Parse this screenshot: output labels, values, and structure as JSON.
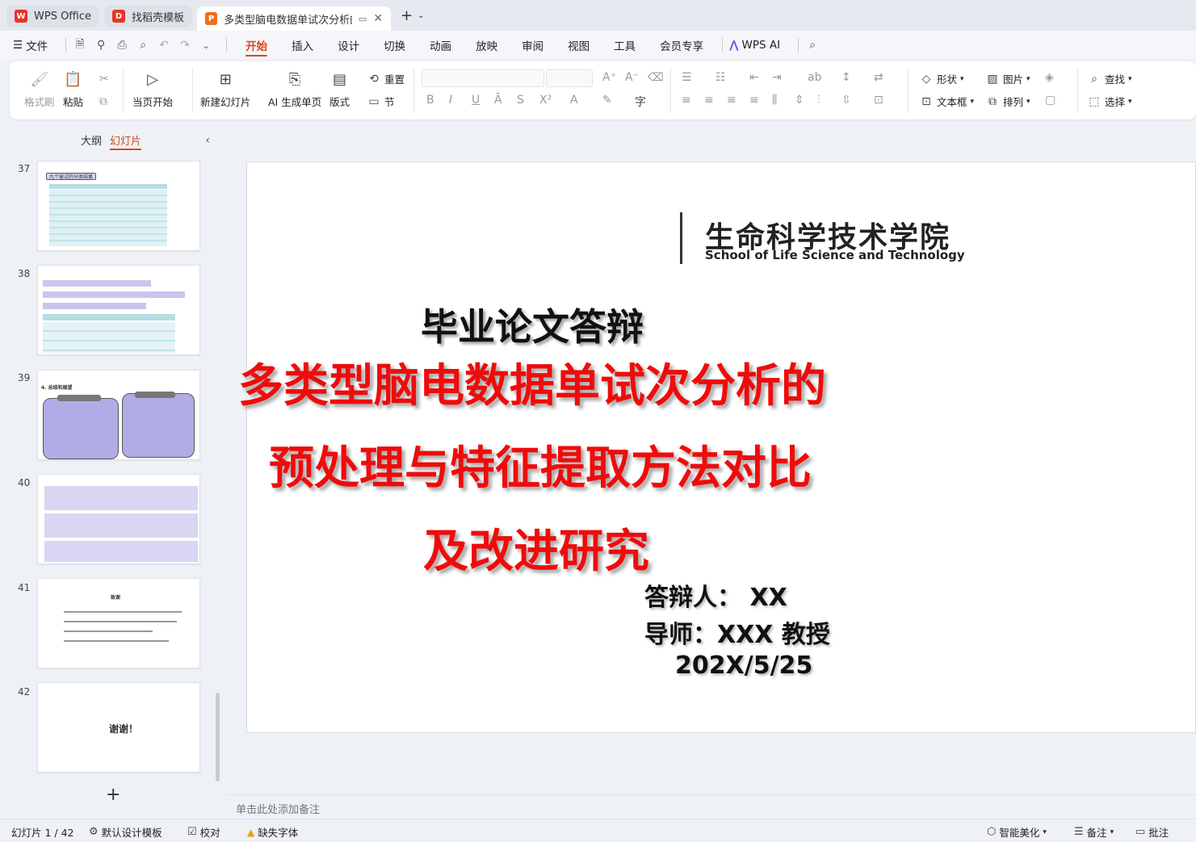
{
  "tabs": [
    {
      "label": "WPS Office",
      "logo": "W",
      "logo_color": "#e8332a"
    },
    {
      "label": "找稻壳模板",
      "logo": "D",
      "logo_color": "#e8332a"
    },
    {
      "label": "多类型脑电数据单试次分析的",
      "logo": "P",
      "logo_color": "#f26b1d"
    }
  ],
  "menubar": {
    "file": "文件",
    "tabs": [
      "开始",
      "插入",
      "设计",
      "切换",
      "动画",
      "放映",
      "审阅",
      "视图",
      "工具",
      "会员专享"
    ],
    "active_tab": "开始",
    "ai": "WPS AI"
  },
  "ribbon": {
    "format_painter": "格式刷",
    "paste": "粘贴",
    "start_from_current": "当页开始",
    "new_slide": "新建幻灯片",
    "ai_generate": "AI 生成单页",
    "layout": "版式",
    "reset": "重置",
    "section": "节",
    "shape": "形状",
    "picture": "图片",
    "find": "查找",
    "textbox": "文本框",
    "arrange": "排列",
    "select": "选择"
  },
  "panel": {
    "outline_tab": "大纲",
    "slides_tab": "幻灯片",
    "slide_numbers": [
      "37",
      "38",
      "39",
      "40",
      "41",
      "42"
    ],
    "thumb37_title": "九个被试的分类结果",
    "thumb39_title": "4. 总结和展望",
    "thumb41_title": "致谢",
    "thumb42_text": "谢谢！"
  },
  "slide": {
    "school_cn": "生命科学技术学院",
    "school_en": "School of Life Science and Technology",
    "heading": "毕业论文答辩",
    "title_line1": "多类型脑电数据单试次分析的",
    "title_line2": "预处理与特征提取方法对比",
    "title_line3": "及改进研究",
    "presenter": "答辩人： XX",
    "advisor": "导师：XXX 教授",
    "date": "202X/5/25",
    "title_color": "#f00b0b"
  },
  "notes": {
    "placeholder": "单击此处添加备注"
  },
  "status": {
    "slide_counter": "幻灯片 1 / 42",
    "design_template": "默认设计模板",
    "proofread": "校对",
    "missing_font": "缺失字体",
    "smart_beautify": "智能美化",
    "notes": "备注",
    "comments": "批注"
  }
}
